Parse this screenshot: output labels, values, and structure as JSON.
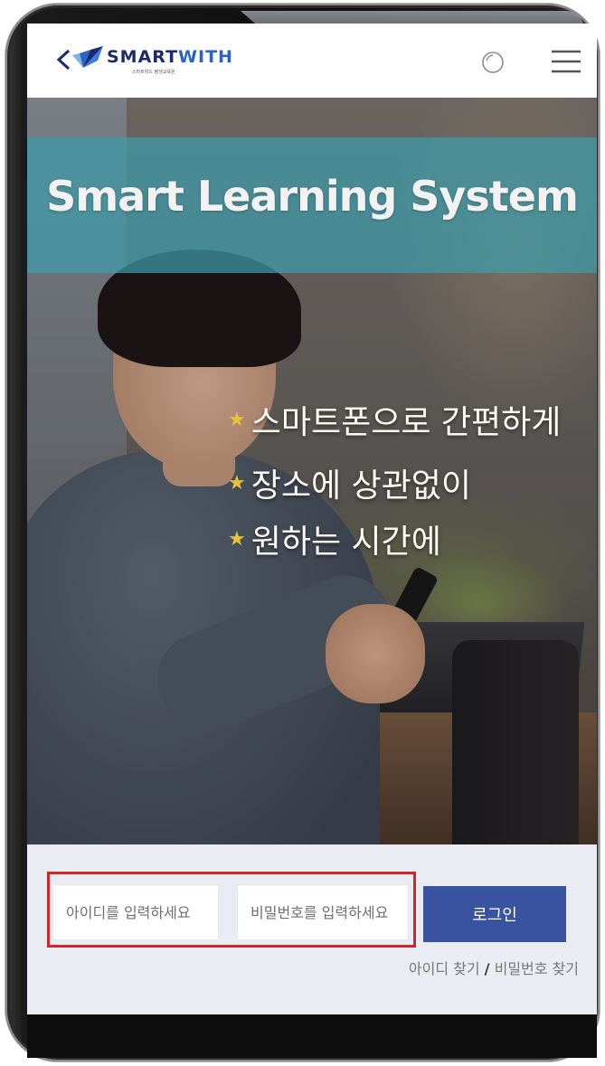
{
  "header": {
    "logo": {
      "title_main": "SMART",
      "title_accent": "WITH",
      "subtitle": "스마트위드 평생교육원"
    },
    "icons": {
      "back": "chevron-left-icon",
      "search": "search-icon",
      "menu": "hamburger-menu-icon"
    }
  },
  "hero": {
    "title": "Smart Learning System",
    "taglines": [
      "스마트폰으로 간편하게",
      "장소에 상관없이",
      "원하는 시간에"
    ],
    "star_color": "#e8c23a",
    "banner_color": "#3f9baa"
  },
  "login": {
    "id_placeholder": "아이디를 입력하세요",
    "password_placeholder": "비밀번호를 입력하세요",
    "login_label": "로그인",
    "find_id_label": "아이디 찾기",
    "separator": "/",
    "find_password_label": "비밀번호 찾기",
    "button_color": "#3a53a0",
    "highlight_color": "#d0252a"
  }
}
